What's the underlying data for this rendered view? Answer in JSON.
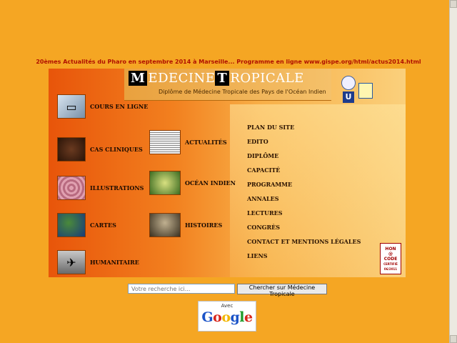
{
  "news_banner": "20èmes Actualités du Pharo en septembre 2014 à Marseille... Programme en ligne www.gispe.org/html/actus2014.html",
  "header": {
    "title_parts": [
      "M",
      "EDECINE ",
      "T",
      "ROPICALE"
    ],
    "subtitle": "Diplôme de Médecine Tropicale des Pays de l'Océan Indien"
  },
  "left_items": [
    {
      "label": "COURS EN LIGNE"
    },
    {
      "label": "CAS CLINIQUES"
    },
    {
      "label": "ILLUSTRATIONS"
    },
    {
      "label": "CARTES"
    },
    {
      "label": "HUMANITAIRE"
    }
  ],
  "mid_items": [
    {
      "label": "ACTUALITÉS"
    },
    {
      "label": "OCÉAN INDIEN"
    },
    {
      "label": "HISTOIRES"
    }
  ],
  "menu": [
    "PLAN DU SITE",
    "EDITO",
    "DIPLÔME",
    "CAPACITÉ",
    "PROGRAMME",
    "ANNALES",
    "LECTURES",
    "CONGRÈS",
    "CONTACT ET MENTIONS LÉGALES",
    "LIENS"
  ],
  "hon": {
    "line1": "HON",
    "line2": "@",
    "line3": "CODE",
    "line4": "CERTIFIÉ",
    "line5": "06/2011"
  },
  "search": {
    "placeholder": "Votre recherche ici...",
    "button": "Chercher sur Médecine Tropicale"
  },
  "google": {
    "avec": "Avec",
    "letters": [
      "G",
      "o",
      "o",
      "g",
      "l",
      "e"
    ],
    "colors": [
      "#1a53c8",
      "#d8261c",
      "#f2b600",
      "#1a53c8",
      "#1f9a2a",
      "#d8261c"
    ]
  },
  "icons": {
    "cours": "computer-icon",
    "cas": "child-icon",
    "illus": "cells-icon",
    "cartes": "globe-icon",
    "huma": "plane-icon",
    "actu": "newspaper-icon",
    "ocean": "plant-icon",
    "hist": "portrait-icon"
  }
}
